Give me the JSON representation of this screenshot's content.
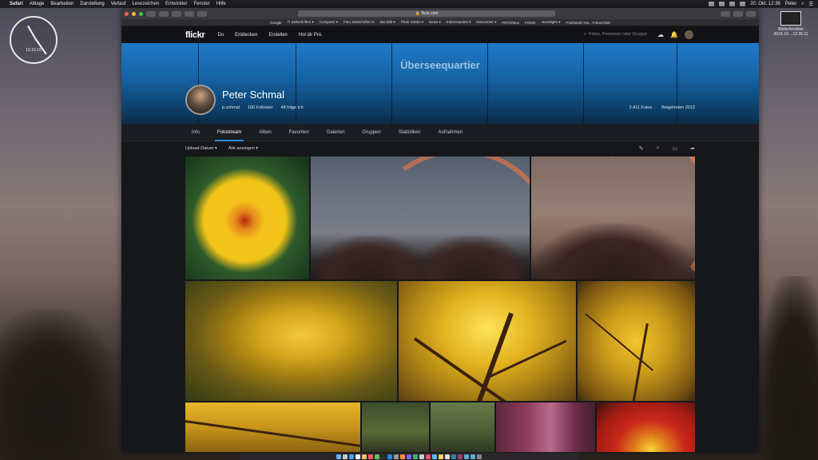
{
  "menubar": {
    "app_name": "Safari",
    "items": [
      "Ablage",
      "Bearbeiten",
      "Darstellung",
      "Verlauf",
      "Lesezeichen",
      "Entwickler",
      "Fenster",
      "Hilfe"
    ],
    "clock": "20. Okt. 12:36",
    "user": "Peter"
  },
  "desktop": {
    "clock_date": "10.10.16",
    "file_name": "Bildschirmfoto",
    "file_date": "2016-10-...12.36.11"
  },
  "browser": {
    "url": "flickr.com",
    "favorites": [
      "Google",
      "IT Zeitschriften ▾",
      "Computer ▾",
      "Foto Zeitschriften ▾",
      "das Bild ▾",
      "Flickr Seiten ▾",
      "News ▾",
      "Interessantes ▾",
      "Discounter ▾",
      "FRITZ!Box",
      "FONIC",
      "Sonstiges ▾",
      "Fotohaven Ha...-Fotoschule"
    ]
  },
  "flickr": {
    "logo": "flickr",
    "nav": [
      "Du",
      "Entdecken",
      "Erstellen",
      "Hol dir Pro."
    ],
    "search_placeholder": "Fotos, Personen oder Gruppe",
    "banner_title": "Überseequartier",
    "profile": {
      "name": "Peter Schmal",
      "username": "p.schmal",
      "followers": "160 Follower",
      "following": "48 folge ich",
      "photo_count": "3.411 Fotos",
      "joined": "Beigetreten 2013"
    },
    "tabs": [
      "Info",
      "Fotostream",
      "Alben",
      "Favoriten",
      "Galerien",
      "Gruppen",
      "Statistiken",
      "Aufnahmen"
    ],
    "active_tab": "Fotostream",
    "filters": {
      "sort": "Upload-Datum ▾",
      "view": "Alle anzeigen ▾"
    },
    "accent_color": "#2a8ad8"
  }
}
